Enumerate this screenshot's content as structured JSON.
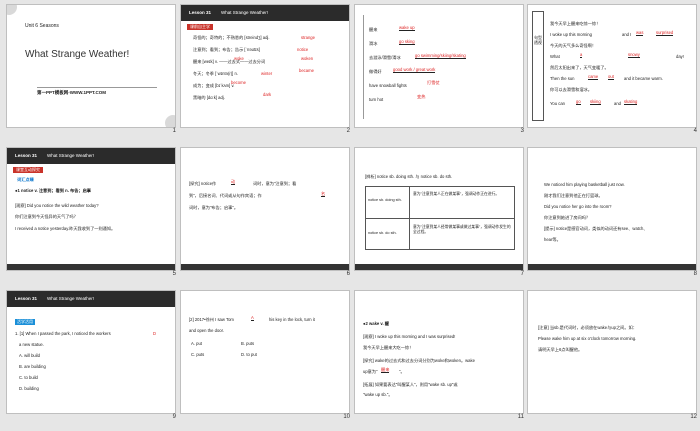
{
  "slides": [
    {
      "n": "1",
      "unit": "Unit 6 Seasons",
      "title": "What Strange Weather!",
      "sub": "第一PPT模板网-WWW.1PPT.COM"
    },
    {
      "n": "2",
      "banner": "课前自主学",
      "lesson": "Lesson 31",
      "lessonTitle": "What Strange Weather!",
      "lines": [
        "奇怪的；奇特的；不熟悉的 [streindʒ] adj.",
        "注意到；看到；布告；告示 [ˈnəʊtɪs]",
        "醒来 [weɪk] v. ——过去式——过去分词",
        "冬天；冬季 [ˈwɪntə(r)] n.",
        "成为；变成 [bɪˈkʌm] v.",
        "黑暗的 [dɑːk] adj."
      ],
      "answers": [
        "strange",
        "notice",
        "woke",
        "woken",
        "winter",
        "became",
        "become",
        "dark"
      ]
    },
    {
      "n": "3",
      "lines": [
        "醒来",
        "滑冰",
        "去游泳/滑雪/滑冰",
        "做得好",
        "have snowball fights",
        "turn hot"
      ],
      "answers": [
        "wake up",
        "go sking",
        "go swimming/skiing/skating",
        "good work / great work",
        "打雪仗",
        "变热"
      ]
    },
    {
      "n": "4",
      "side": "句型透视",
      "lines": [
        "我今天早上醒来吃惊一惊！",
        "I woke up this morning",
        "and I",
        "今天的天气多么奇怪啊！",
        "What",
        "day!",
        "然后太阳出来了，天气变暖了。",
        "Then the sun",
        "and it became warm.",
        "你可以去滑雪和溜冰。",
        "You can",
        "and"
      ],
      "answers": [
        "was",
        "surprised",
        "a",
        "snowy",
        "came",
        "out",
        "go",
        "skiing",
        "skating"
      ]
    },
    {
      "n": "5",
      "banner": "课堂互动探究",
      "lesson": "Lesson 31",
      "lessonTitle": "What Strange Weather!",
      "label": "词汇点睛",
      "lines": [
        "●1 notice v. 注意到；看到 n. 布告；启事",
        "[观察] Did you notice the wild weather today?",
        "你们注意到今天怪异的天气了吗？",
        "I received a notice yesterday.昨天我收到了一则通知。"
      ]
    },
    {
      "n": "6",
      "lines": [
        "[探究] notice作",
        "词时，意为\"注意到；看",
        "到\"，后接名词、代词或从句作宾语；作",
        "词时，意为\"布告；启事\"。"
      ],
      "answers": [
        "动",
        "名"
      ]
    },
    {
      "n": "7",
      "head": "[辨析] notice sb. doing sth. 与 notice sb. do sth.",
      "rows": [
        [
          "notice sb. doing sth.",
          "意为\"注意到某人正在做某事\"，强调动作正在进行。"
        ],
        [
          "notice sb. do sth.",
          "意为\"注意到某人经常做某事或做过某事\"，强调动作发生的全过程。"
        ]
      ]
    },
    {
      "n": "8",
      "lines": [
        "We noticed him playing basketball just now.",
        "刚才我们注意到他正在打篮球。",
        "Did you notice her go into the room?",
        "你注意到她进了房间吗？",
        "[提示] notice是感官动词，类似的动词还有see、watch、",
        "hear等。"
      ]
    },
    {
      "n": "9",
      "lesson": "Lesson 31",
      "lessonTitle": "What Strange Weather!",
      "label": "活学活用",
      "lines": [
        "1. [1] When I passed the park, I noticed the workers",
        "a new statue.",
        "A. will build",
        "B. are building",
        "C. to build",
        "D. building"
      ],
      "answer": "D"
    },
    {
      "n": "10",
      "lines": [
        "[2] 2017•徐州 I saw Tom",
        "his key in the lock, turn it",
        "and open the door.",
        "A. put",
        "B. puts",
        "C. puts",
        "D. to put"
      ],
      "answer": "A"
    },
    {
      "n": "11",
      "lines": [
        "●2 wake v. 醒",
        "[观察] I woke up this morning and I was surprised!",
        "我今天早上醒来大吃一惊！",
        "[探究] wake的过去式和过去分词分别为woke和woken。wake",
        "up意为\"",
        "\"。",
        "[拓展] 如果要表达\"叫醒某人\"，则用\"wake sb. up\"或",
        "\"wake up sb.\"。"
      ],
      "answer": "醒来"
    },
    {
      "n": "12",
      "lines": [
        "[注意] 当sb.是代词时，必须放在wake与up之间。如：",
        "Please wake him up at six o'clock tomorrow morning.",
        "请明天早上6点叫醒他。"
      ]
    }
  ]
}
